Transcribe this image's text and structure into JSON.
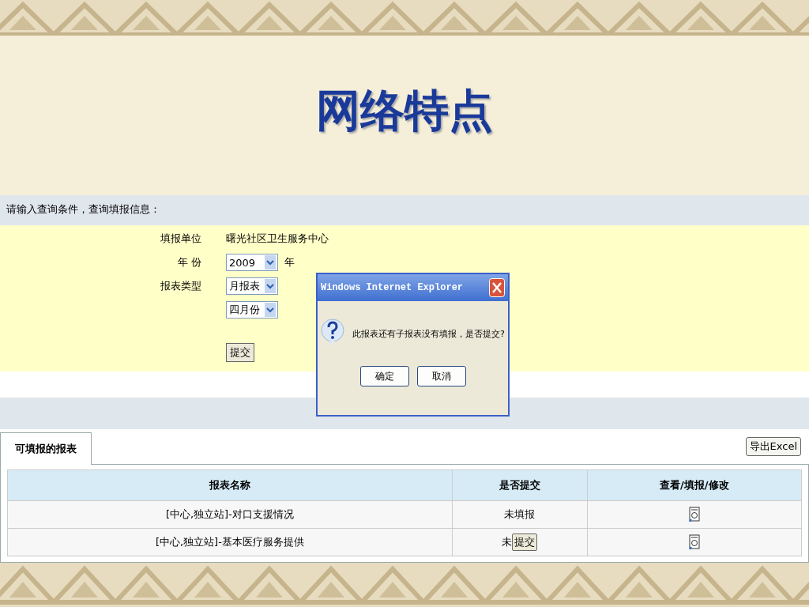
{
  "slide": {
    "title": "网络特点"
  },
  "page": {
    "query_prompt": "请输入查询条件，查询填报信息：",
    "form": {
      "fields": [
        {
          "label": "填报单位",
          "kind": "text",
          "value": "曙光社区卫生服务中心"
        },
        {
          "label": "年 份",
          "kind": "select",
          "value": "2009",
          "suffix": "年"
        },
        {
          "label": "报表类型",
          "kind": "select",
          "value": "月报表"
        },
        {
          "kind": "select",
          "value": "四月份"
        }
      ],
      "submit_button": "提交"
    },
    "tab": {
      "label": "可填报的报表",
      "selected": true
    },
    "export_button": "导出Excel",
    "table": {
      "columns": [
        "报表名称",
        "是否提交",
        "查看/填报/修改"
      ],
      "rows": [
        {
          "name": "[中心,独立站]-对口支援情况",
          "status": "未填报"
        },
        {
          "name": "[中心,独立站]-基本医疗服务提供",
          "status": "未",
          "submit_button": "提交"
        }
      ]
    }
  },
  "dialog": {
    "title": "Windows Internet Explorer",
    "message": "此报表还有子报表没有填报，是否提交?",
    "buttons": [
      "确定",
      "取消"
    ]
  }
}
